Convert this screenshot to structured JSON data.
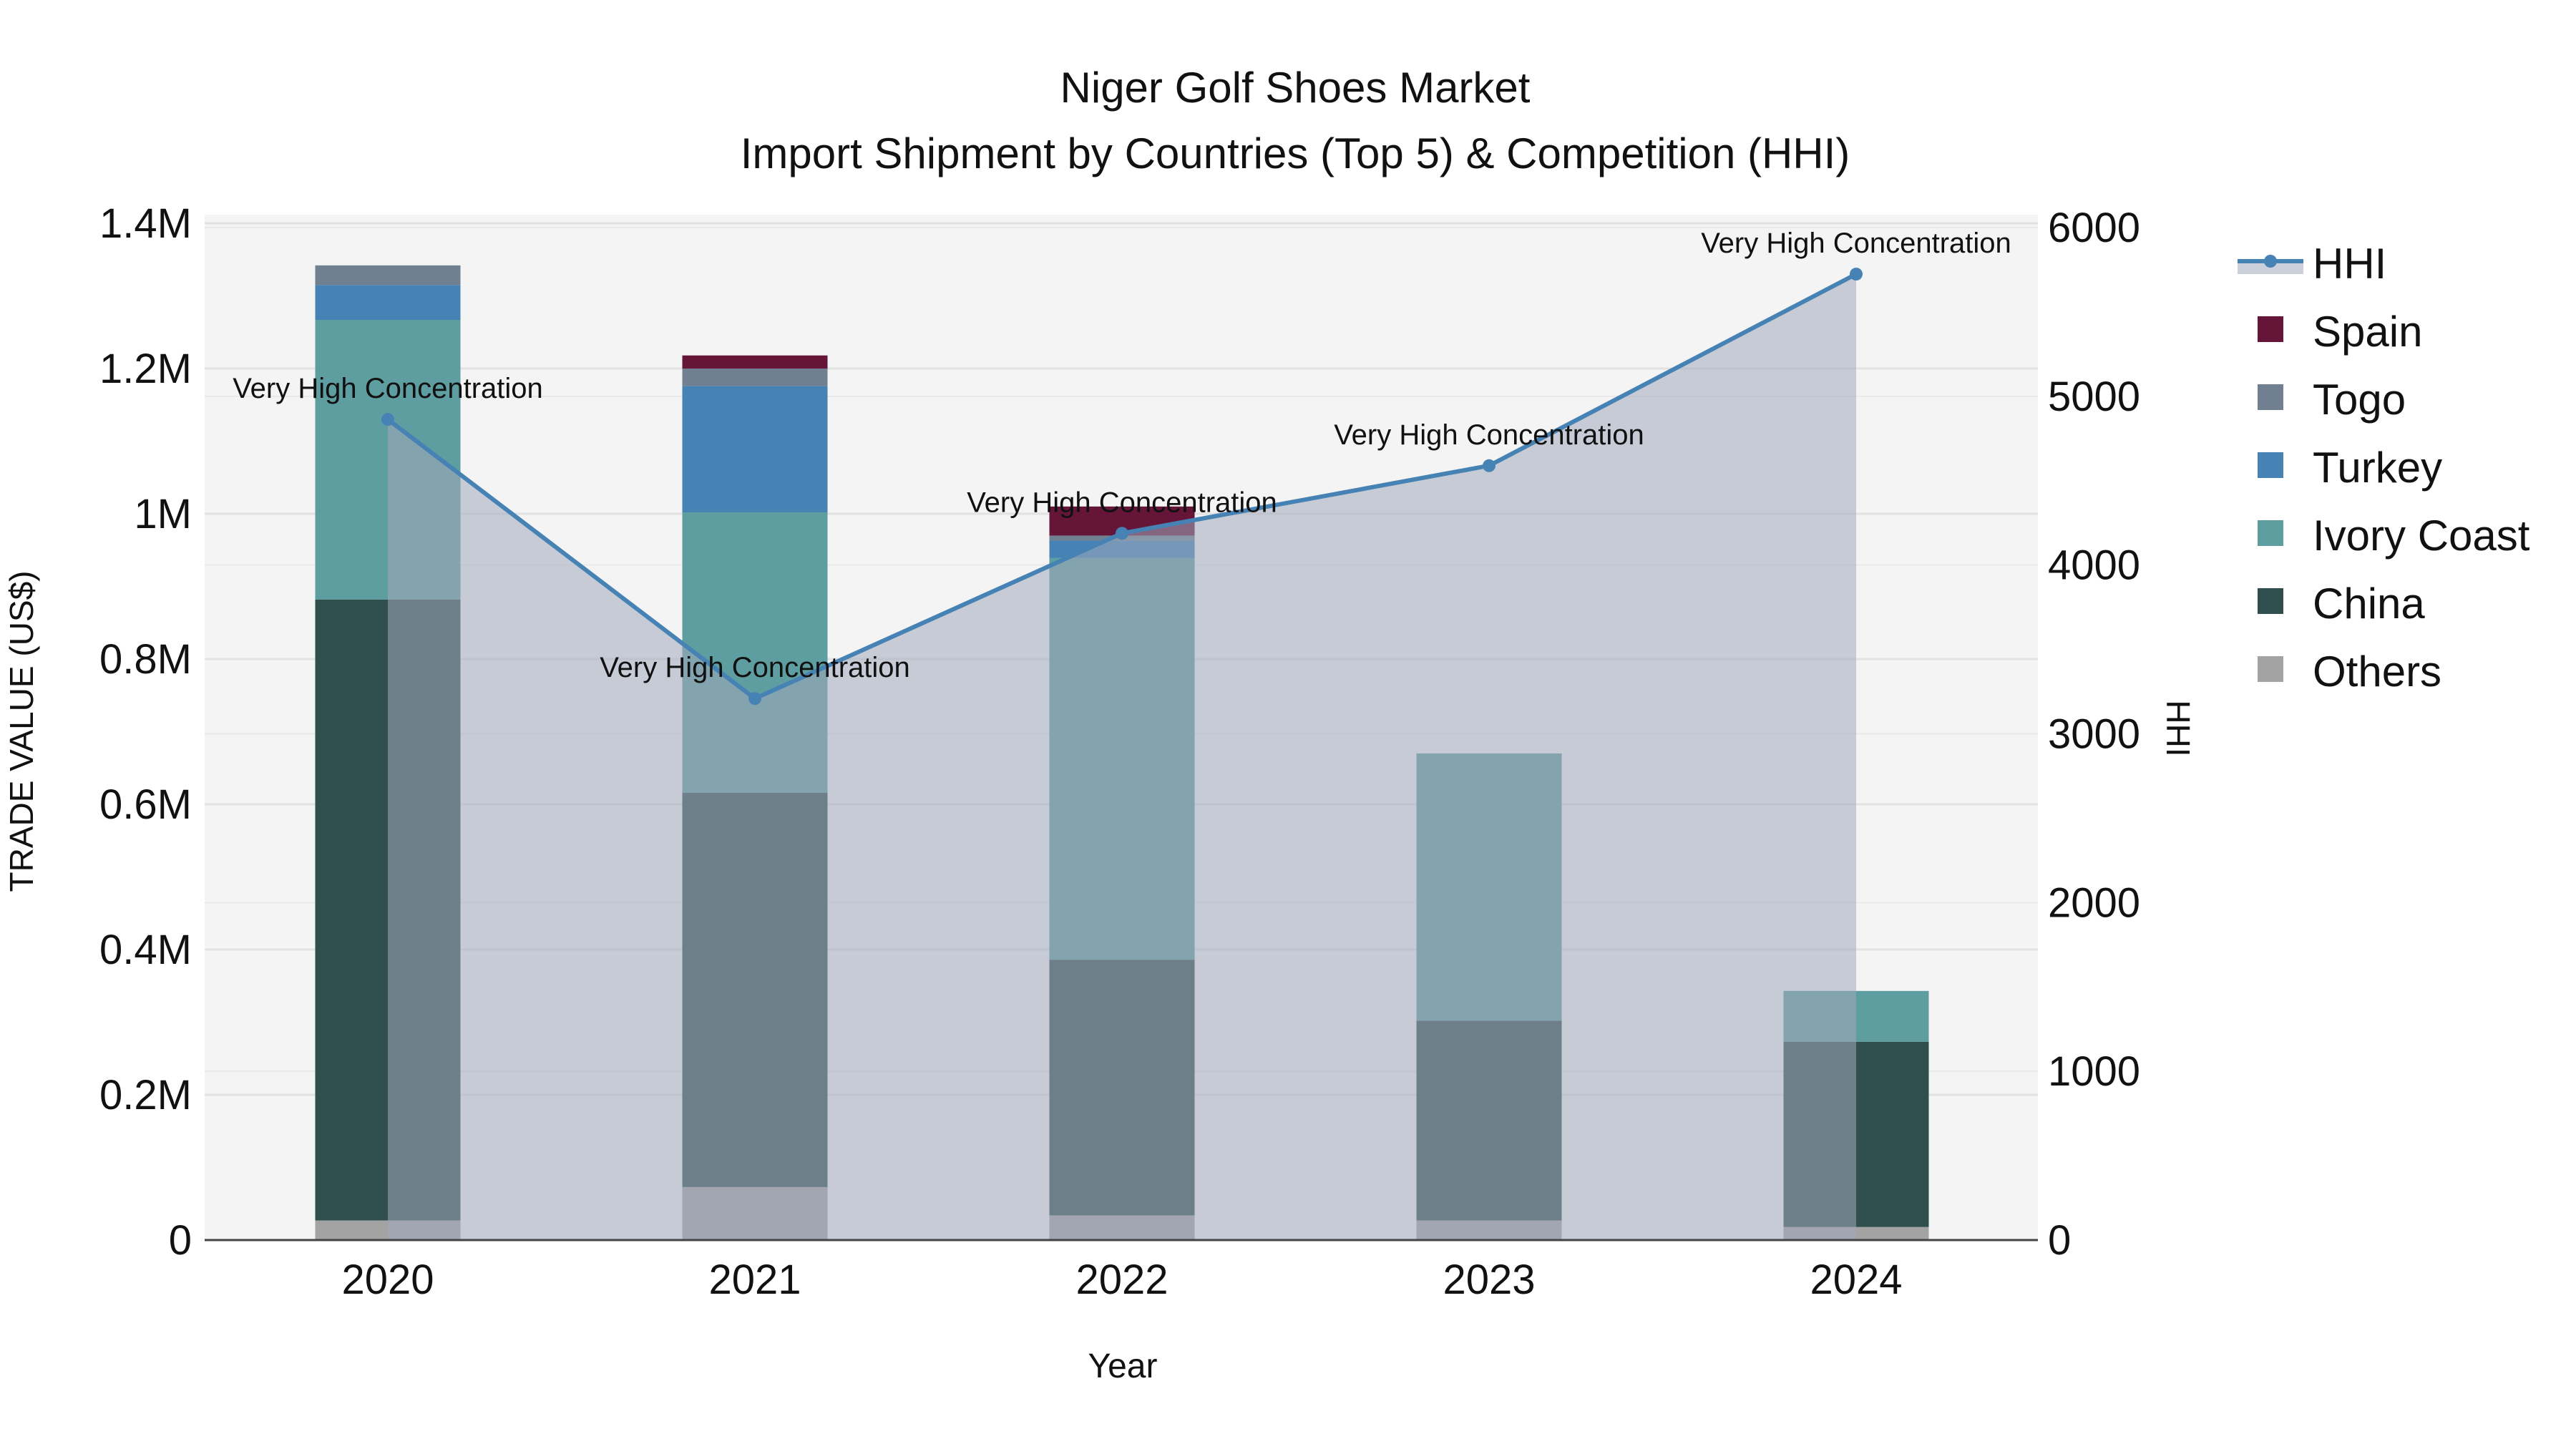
{
  "chart_data": {
    "type": "bar",
    "title": "Niger Golf Shoes Market",
    "subtitle": "Import Shipment by Countries (Top 5) & Competition (HHI)",
    "xlabel": "Year",
    "ylabel": "TRADE VALUE (US$)",
    "y2label": "HHI",
    "categories": [
      "2020",
      "2021",
      "2022",
      "2023",
      "2024"
    ],
    "ylim": [
      0,
      1400000
    ],
    "y2lim": [
      0,
      6000
    ],
    "yticks": [
      {
        "v": 0,
        "label": "0"
      },
      {
        "v": 200000,
        "label": "0.2M"
      },
      {
        "v": 400000,
        "label": "0.4M"
      },
      {
        "v": 600000,
        "label": "0.6M"
      },
      {
        "v": 800000,
        "label": "0.8M"
      },
      {
        "v": 1000000,
        "label": "1M"
      },
      {
        "v": 1200000,
        "label": "1.2M"
      },
      {
        "v": 1400000,
        "label": "1.4M"
      }
    ],
    "y2ticks": [
      0,
      1000,
      2000,
      3000,
      4000,
      5000,
      6000
    ],
    "series": [
      {
        "name": "Others",
        "color": "#a3a3a3",
        "values": [
          27000,
          73000,
          34000,
          27000,
          18000
        ]
      },
      {
        "name": "China",
        "color": "#2f4f4f",
        "values": [
          855000,
          543000,
          352000,
          275000,
          255000
        ]
      },
      {
        "name": "Ivory Coast",
        "color": "#5f9ea0",
        "values": [
          385000,
          386000,
          553000,
          368000,
          70000
        ]
      },
      {
        "name": "Turkey",
        "color": "#4682b4",
        "values": [
          48000,
          174000,
          24000,
          0,
          0
        ]
      },
      {
        "name": "Togo",
        "color": "#708090",
        "values": [
          27000,
          24000,
          7000,
          0,
          0
        ]
      },
      {
        "name": "Spain",
        "color": "#641538",
        "values": [
          0,
          18000,
          40000,
          0,
          0
        ]
      }
    ],
    "hhi": {
      "name": "HHI",
      "color": "#4682b4",
      "values": [
        4863,
        3209,
        4188,
        4589,
        5724
      ],
      "annotations": [
        "Very High Concentration",
        "Very High Concentration",
        "Very High Concentration",
        "Very High Concentration",
        "Very High Concentration"
      ]
    },
    "legend": {
      "placement": "right",
      "order": [
        "HHI",
        "Spain",
        "Togo",
        "Turkey",
        "Ivory Coast",
        "China",
        "Others"
      ]
    },
    "grid": true
  }
}
